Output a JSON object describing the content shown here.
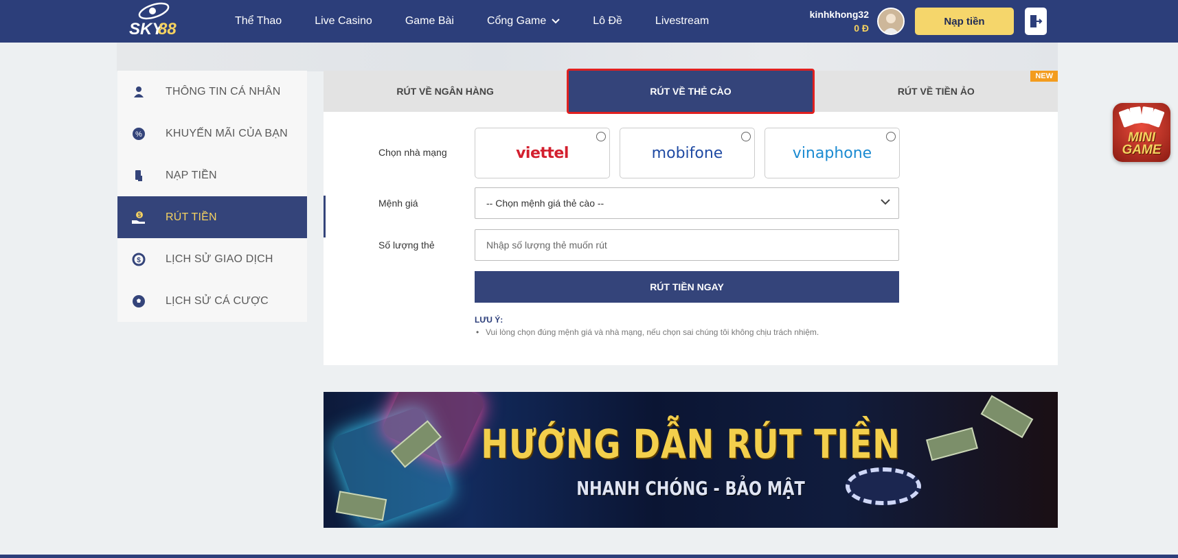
{
  "header": {
    "logo_text": "SKY88",
    "nav": [
      {
        "label": "Thể Thao"
      },
      {
        "label": "Live Casino"
      },
      {
        "label": "Game Bài"
      },
      {
        "label": "Cổng Game",
        "has_dropdown": true
      },
      {
        "label": "Lô Đề"
      },
      {
        "label": "Livestream"
      }
    ],
    "username": "kinhkhong32",
    "balance": "0 Đ",
    "deposit_label": "Nạp tiền"
  },
  "sidebar": {
    "items": [
      {
        "label": "THÔNG TIN CÁ NHÂN",
        "icon": "user-icon"
      },
      {
        "label": "KHUYẾN MÃI CỦA BẠN",
        "icon": "promo-icon"
      },
      {
        "label": "NẠP TIỀN",
        "icon": "deposit-icon"
      },
      {
        "label": "RÚT TIỀN",
        "icon": "withdraw-icon",
        "active": true
      },
      {
        "label": "LỊCH SỬ GIAO DỊCH",
        "icon": "transaction-history-icon"
      },
      {
        "label": "LỊCH SỬ CÁ CƯỢC",
        "icon": "soccer-ball-icon"
      }
    ]
  },
  "tabs": [
    {
      "label": "RÚT VỀ NGÂN HÀNG"
    },
    {
      "label": "RÚT VỀ THẺ CÀO",
      "active": true
    },
    {
      "label": "RÚT VỀ TIỀN ẢO",
      "badge": "NEW"
    }
  ],
  "form": {
    "carrier_label": "Chọn nhà mạng",
    "carriers": [
      {
        "name": "viettel",
        "color": "#d3202f"
      },
      {
        "name": "mobifone",
        "color": "#1f4aa3"
      },
      {
        "name": "vinaphone",
        "color": "#1a8ad1"
      }
    ],
    "denomination_label": "Mệnh giá",
    "denomination_value": "-- Chọn mệnh giá thẻ cào --",
    "quantity_label": "Số lượng thẻ",
    "quantity_placeholder": "Nhập số lượng thẻ muốn rút",
    "submit_label": "RÚT TIỀN NGAY",
    "note_title": "LƯU Ý:",
    "note_text": "Vui lòng chọn đúng mệnh giá và nhà mạng, nếu chọn sai chúng tôi không chịu trách nhiệm."
  },
  "banner": {
    "title": "HƯỚNG DẪN RÚT TIỀN",
    "subtitle": "NHANH CHÓNG - BẢO MẬT"
  },
  "minigame": {
    "label_line1": "MINI",
    "label_line2": "GAME"
  },
  "colors": {
    "primary": "#2c3e7a",
    "accent": "#f5d260",
    "highlight": "#e02020",
    "badge": "#f39c1e"
  }
}
